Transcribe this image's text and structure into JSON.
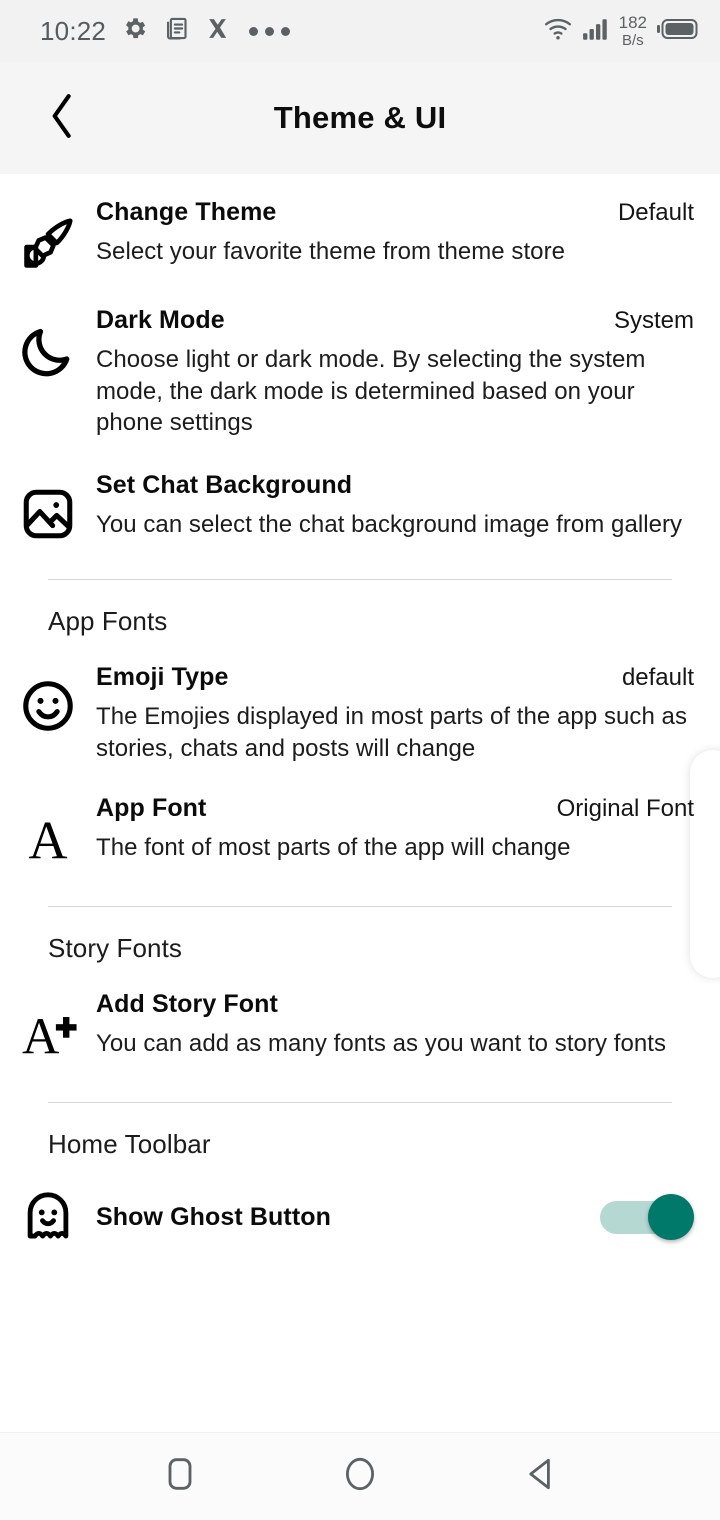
{
  "status_bar": {
    "time": "10:22",
    "left_icons": [
      "gear-icon",
      "notes-icon",
      "x-icon",
      "more-dots-icon"
    ],
    "network_speed_value": "182",
    "network_speed_unit": "B/s",
    "right_icons": [
      "wifi-icon",
      "cellular-signal-icon",
      "battery-icon"
    ]
  },
  "app_bar": {
    "back_icon": "chevron-left-icon",
    "title": "Theme & UI"
  },
  "settings": {
    "items": [
      {
        "icon": "paintbrush-icon",
        "title": "Change Theme",
        "value": "Default",
        "subtitle": "Select your favorite theme from theme store"
      },
      {
        "icon": "moon-icon",
        "title": "Dark Mode",
        "value": "System",
        "subtitle": "Choose light or dark mode. By selecting the system mode, the dark mode is determined based on your phone settings"
      },
      {
        "icon": "image-icon",
        "title": "Set Chat Background",
        "value": "",
        "subtitle": "You can select the chat background image from gallery"
      }
    ]
  },
  "sections": [
    {
      "label": "App Fonts",
      "items": [
        {
          "icon": "smiley-face-icon",
          "title": "Emoji Type",
          "value": "default",
          "subtitle": "The Emojies displayed in most parts of the app such as stories, chats and posts will change"
        },
        {
          "icon": "letter-a-icon",
          "title": "App Font",
          "value": "Original Font",
          "subtitle": "The font of most parts of the app will change"
        }
      ]
    },
    {
      "label": "Story Fonts",
      "items": [
        {
          "icon": "letter-a-plus-icon",
          "title": "Add Story Font",
          "value": "",
          "subtitle": "You can add as many fonts as you want to story fonts"
        }
      ]
    },
    {
      "label": "Home Toolbar",
      "items": [
        {
          "icon": "ghost-icon",
          "title": "Show Ghost Button",
          "value": "",
          "subtitle": "",
          "toggle_on": true
        }
      ]
    }
  ],
  "colors": {
    "toggle_thumb": "#00796b",
    "toggle_track": "#b5d8d3",
    "status_bar_bg": "#f2f2f2",
    "app_bar_bg": "#f5f5f5",
    "text_primary": "#0b0b0b"
  },
  "nav_bar": {
    "buttons": [
      "recents-square-icon",
      "home-circle-icon",
      "back-triangle-icon"
    ]
  }
}
